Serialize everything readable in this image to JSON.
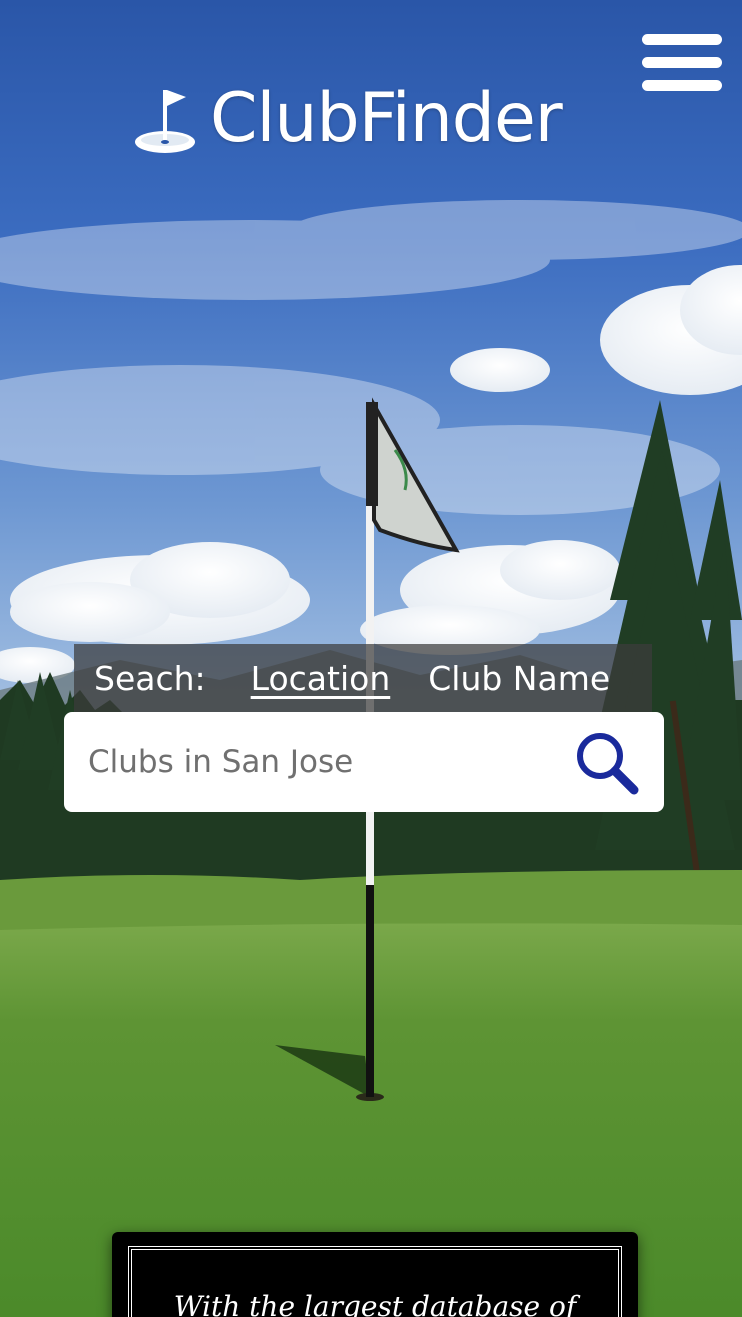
{
  "header": {
    "brand": "ClubFinder",
    "logo_icon": "golf-flag-icon",
    "menu_icon": "hamburger-menu-icon"
  },
  "search": {
    "label": "Seach:",
    "tabs": [
      "Location",
      "Club Name"
    ],
    "active_tab": "Location",
    "placeholder": "Clubs in San Jose",
    "value": "",
    "submit_icon": "magnifier-search-icon"
  },
  "banner": {
    "text": "With the largest database of"
  },
  "colors": {
    "search_icon": "#1a2a9c",
    "tab_bar_bg": "#3c3c3c",
    "banner_bg": "#000000"
  }
}
